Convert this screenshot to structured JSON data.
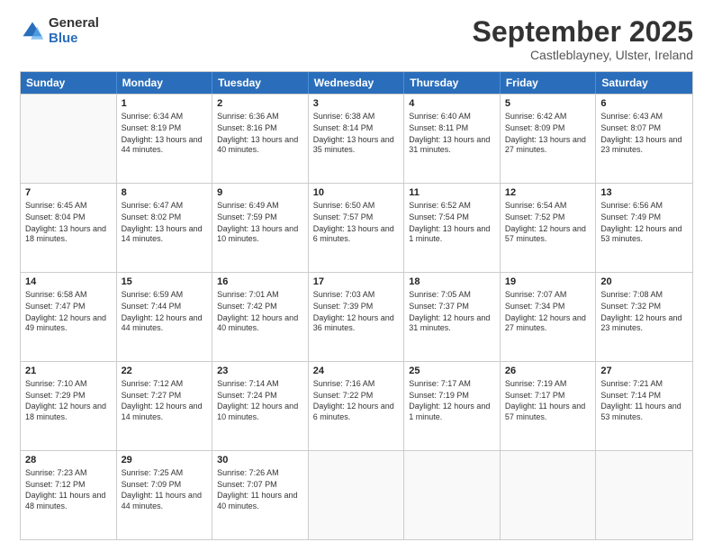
{
  "logo": {
    "general": "General",
    "blue": "Blue"
  },
  "title": {
    "month": "September 2025",
    "location": "Castleblayney, Ulster, Ireland"
  },
  "days": [
    "Sunday",
    "Monday",
    "Tuesday",
    "Wednesday",
    "Thursday",
    "Friday",
    "Saturday"
  ],
  "weeks": [
    [
      {
        "date": "",
        "sunrise": "",
        "sunset": "",
        "daylight": ""
      },
      {
        "date": "1",
        "sunrise": "Sunrise: 6:34 AM",
        "sunset": "Sunset: 8:19 PM",
        "daylight": "Daylight: 13 hours and 44 minutes."
      },
      {
        "date": "2",
        "sunrise": "Sunrise: 6:36 AM",
        "sunset": "Sunset: 8:16 PM",
        "daylight": "Daylight: 13 hours and 40 minutes."
      },
      {
        "date": "3",
        "sunrise": "Sunrise: 6:38 AM",
        "sunset": "Sunset: 8:14 PM",
        "daylight": "Daylight: 13 hours and 35 minutes."
      },
      {
        "date": "4",
        "sunrise": "Sunrise: 6:40 AM",
        "sunset": "Sunset: 8:11 PM",
        "daylight": "Daylight: 13 hours and 31 minutes."
      },
      {
        "date": "5",
        "sunrise": "Sunrise: 6:42 AM",
        "sunset": "Sunset: 8:09 PM",
        "daylight": "Daylight: 13 hours and 27 minutes."
      },
      {
        "date": "6",
        "sunrise": "Sunrise: 6:43 AM",
        "sunset": "Sunset: 8:07 PM",
        "daylight": "Daylight: 13 hours and 23 minutes."
      }
    ],
    [
      {
        "date": "7",
        "sunrise": "Sunrise: 6:45 AM",
        "sunset": "Sunset: 8:04 PM",
        "daylight": "Daylight: 13 hours and 18 minutes."
      },
      {
        "date": "8",
        "sunrise": "Sunrise: 6:47 AM",
        "sunset": "Sunset: 8:02 PM",
        "daylight": "Daylight: 13 hours and 14 minutes."
      },
      {
        "date": "9",
        "sunrise": "Sunrise: 6:49 AM",
        "sunset": "Sunset: 7:59 PM",
        "daylight": "Daylight: 13 hours and 10 minutes."
      },
      {
        "date": "10",
        "sunrise": "Sunrise: 6:50 AM",
        "sunset": "Sunset: 7:57 PM",
        "daylight": "Daylight: 13 hours and 6 minutes."
      },
      {
        "date": "11",
        "sunrise": "Sunrise: 6:52 AM",
        "sunset": "Sunset: 7:54 PM",
        "daylight": "Daylight: 13 hours and 1 minute."
      },
      {
        "date": "12",
        "sunrise": "Sunrise: 6:54 AM",
        "sunset": "Sunset: 7:52 PM",
        "daylight": "Daylight: 12 hours and 57 minutes."
      },
      {
        "date": "13",
        "sunrise": "Sunrise: 6:56 AM",
        "sunset": "Sunset: 7:49 PM",
        "daylight": "Daylight: 12 hours and 53 minutes."
      }
    ],
    [
      {
        "date": "14",
        "sunrise": "Sunrise: 6:58 AM",
        "sunset": "Sunset: 7:47 PM",
        "daylight": "Daylight: 12 hours and 49 minutes."
      },
      {
        "date": "15",
        "sunrise": "Sunrise: 6:59 AM",
        "sunset": "Sunset: 7:44 PM",
        "daylight": "Daylight: 12 hours and 44 minutes."
      },
      {
        "date": "16",
        "sunrise": "Sunrise: 7:01 AM",
        "sunset": "Sunset: 7:42 PM",
        "daylight": "Daylight: 12 hours and 40 minutes."
      },
      {
        "date": "17",
        "sunrise": "Sunrise: 7:03 AM",
        "sunset": "Sunset: 7:39 PM",
        "daylight": "Daylight: 12 hours and 36 minutes."
      },
      {
        "date": "18",
        "sunrise": "Sunrise: 7:05 AM",
        "sunset": "Sunset: 7:37 PM",
        "daylight": "Daylight: 12 hours and 31 minutes."
      },
      {
        "date": "19",
        "sunrise": "Sunrise: 7:07 AM",
        "sunset": "Sunset: 7:34 PM",
        "daylight": "Daylight: 12 hours and 27 minutes."
      },
      {
        "date": "20",
        "sunrise": "Sunrise: 7:08 AM",
        "sunset": "Sunset: 7:32 PM",
        "daylight": "Daylight: 12 hours and 23 minutes."
      }
    ],
    [
      {
        "date": "21",
        "sunrise": "Sunrise: 7:10 AM",
        "sunset": "Sunset: 7:29 PM",
        "daylight": "Daylight: 12 hours and 18 minutes."
      },
      {
        "date": "22",
        "sunrise": "Sunrise: 7:12 AM",
        "sunset": "Sunset: 7:27 PM",
        "daylight": "Daylight: 12 hours and 14 minutes."
      },
      {
        "date": "23",
        "sunrise": "Sunrise: 7:14 AM",
        "sunset": "Sunset: 7:24 PM",
        "daylight": "Daylight: 12 hours and 10 minutes."
      },
      {
        "date": "24",
        "sunrise": "Sunrise: 7:16 AM",
        "sunset": "Sunset: 7:22 PM",
        "daylight": "Daylight: 12 hours and 6 minutes."
      },
      {
        "date": "25",
        "sunrise": "Sunrise: 7:17 AM",
        "sunset": "Sunset: 7:19 PM",
        "daylight": "Daylight: 12 hours and 1 minute."
      },
      {
        "date": "26",
        "sunrise": "Sunrise: 7:19 AM",
        "sunset": "Sunset: 7:17 PM",
        "daylight": "Daylight: 11 hours and 57 minutes."
      },
      {
        "date": "27",
        "sunrise": "Sunrise: 7:21 AM",
        "sunset": "Sunset: 7:14 PM",
        "daylight": "Daylight: 11 hours and 53 minutes."
      }
    ],
    [
      {
        "date": "28",
        "sunrise": "Sunrise: 7:23 AM",
        "sunset": "Sunset: 7:12 PM",
        "daylight": "Daylight: 11 hours and 48 minutes."
      },
      {
        "date": "29",
        "sunrise": "Sunrise: 7:25 AM",
        "sunset": "Sunset: 7:09 PM",
        "daylight": "Daylight: 11 hours and 44 minutes."
      },
      {
        "date": "30",
        "sunrise": "Sunrise: 7:26 AM",
        "sunset": "Sunset: 7:07 PM",
        "daylight": "Daylight: 11 hours and 40 minutes."
      },
      {
        "date": "",
        "sunrise": "",
        "sunset": "",
        "daylight": ""
      },
      {
        "date": "",
        "sunrise": "",
        "sunset": "",
        "daylight": ""
      },
      {
        "date": "",
        "sunrise": "",
        "sunset": "",
        "daylight": ""
      },
      {
        "date": "",
        "sunrise": "",
        "sunset": "",
        "daylight": ""
      }
    ]
  ]
}
